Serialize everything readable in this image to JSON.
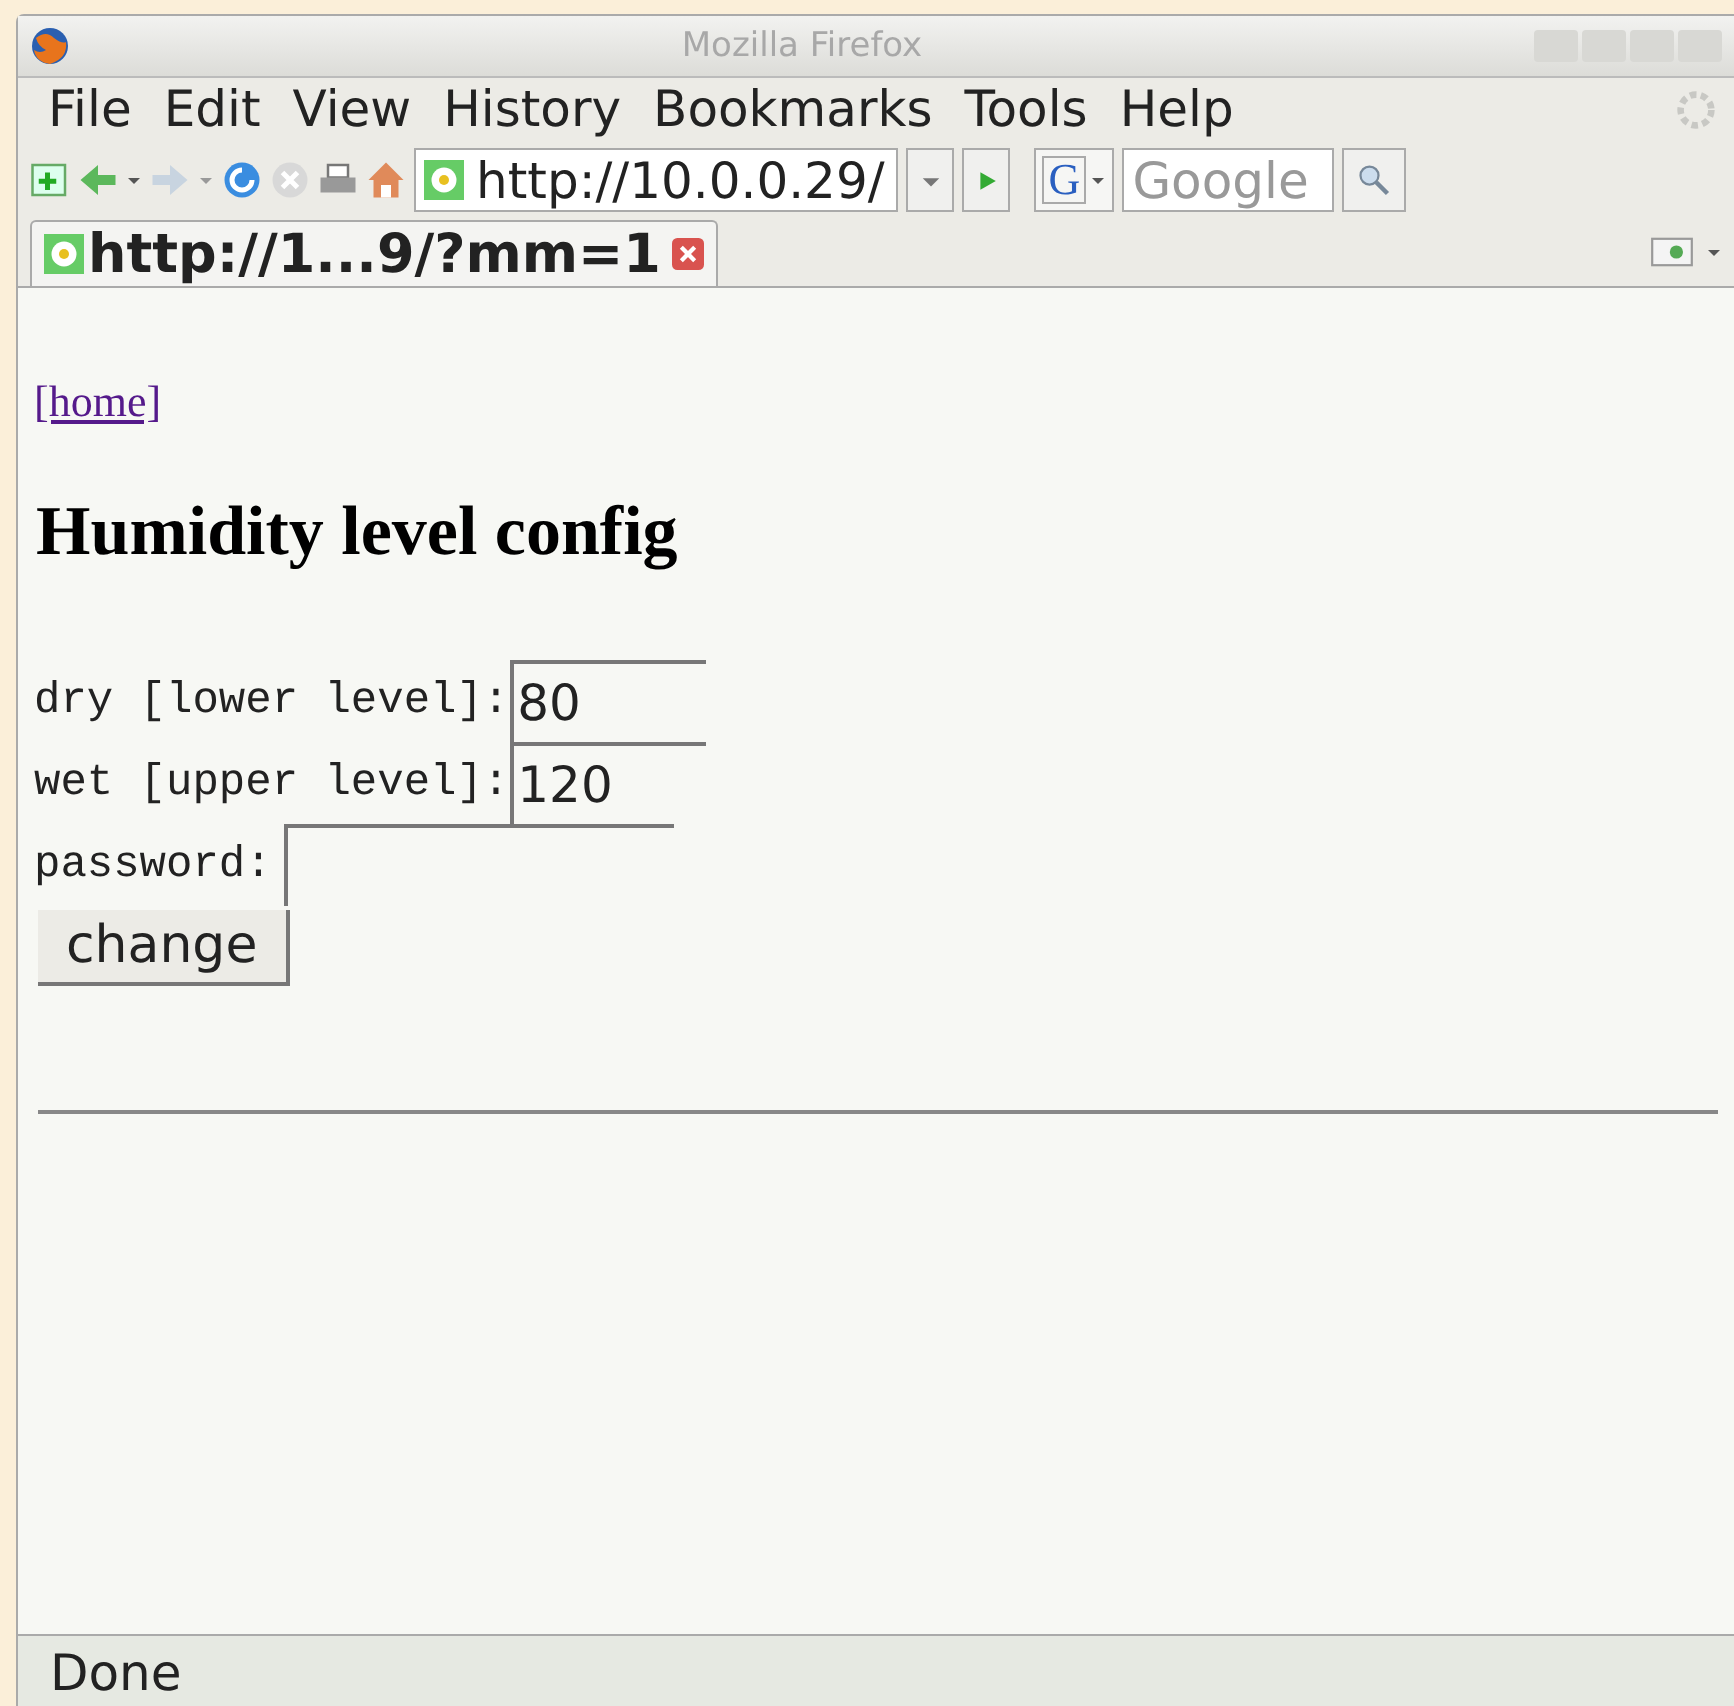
{
  "window": {
    "title": "Mozilla Firefox"
  },
  "menu": [
    "File",
    "Edit",
    "View",
    "History",
    "Bookmarks",
    "Tools",
    "Help"
  ],
  "address": {
    "value": "http://10.0.0.29/"
  },
  "search_engine": {
    "label": "G"
  },
  "search": {
    "placeholder": "Google"
  },
  "tabs": [
    {
      "label": "http://1...9/?mm=1",
      "selected": true
    }
  ],
  "page": {
    "link": "[home]",
    "heading": "Humidity level config",
    "fields": [
      {
        "label": "dry [lower level]:",
        "value": "80",
        "kind": "text"
      },
      {
        "label": "wet [upper level]:",
        "value": "120",
        "kind": "text"
      },
      {
        "label": "password:",
        "kind": "password"
      }
    ],
    "button": "change"
  },
  "status_bar": "Done"
}
